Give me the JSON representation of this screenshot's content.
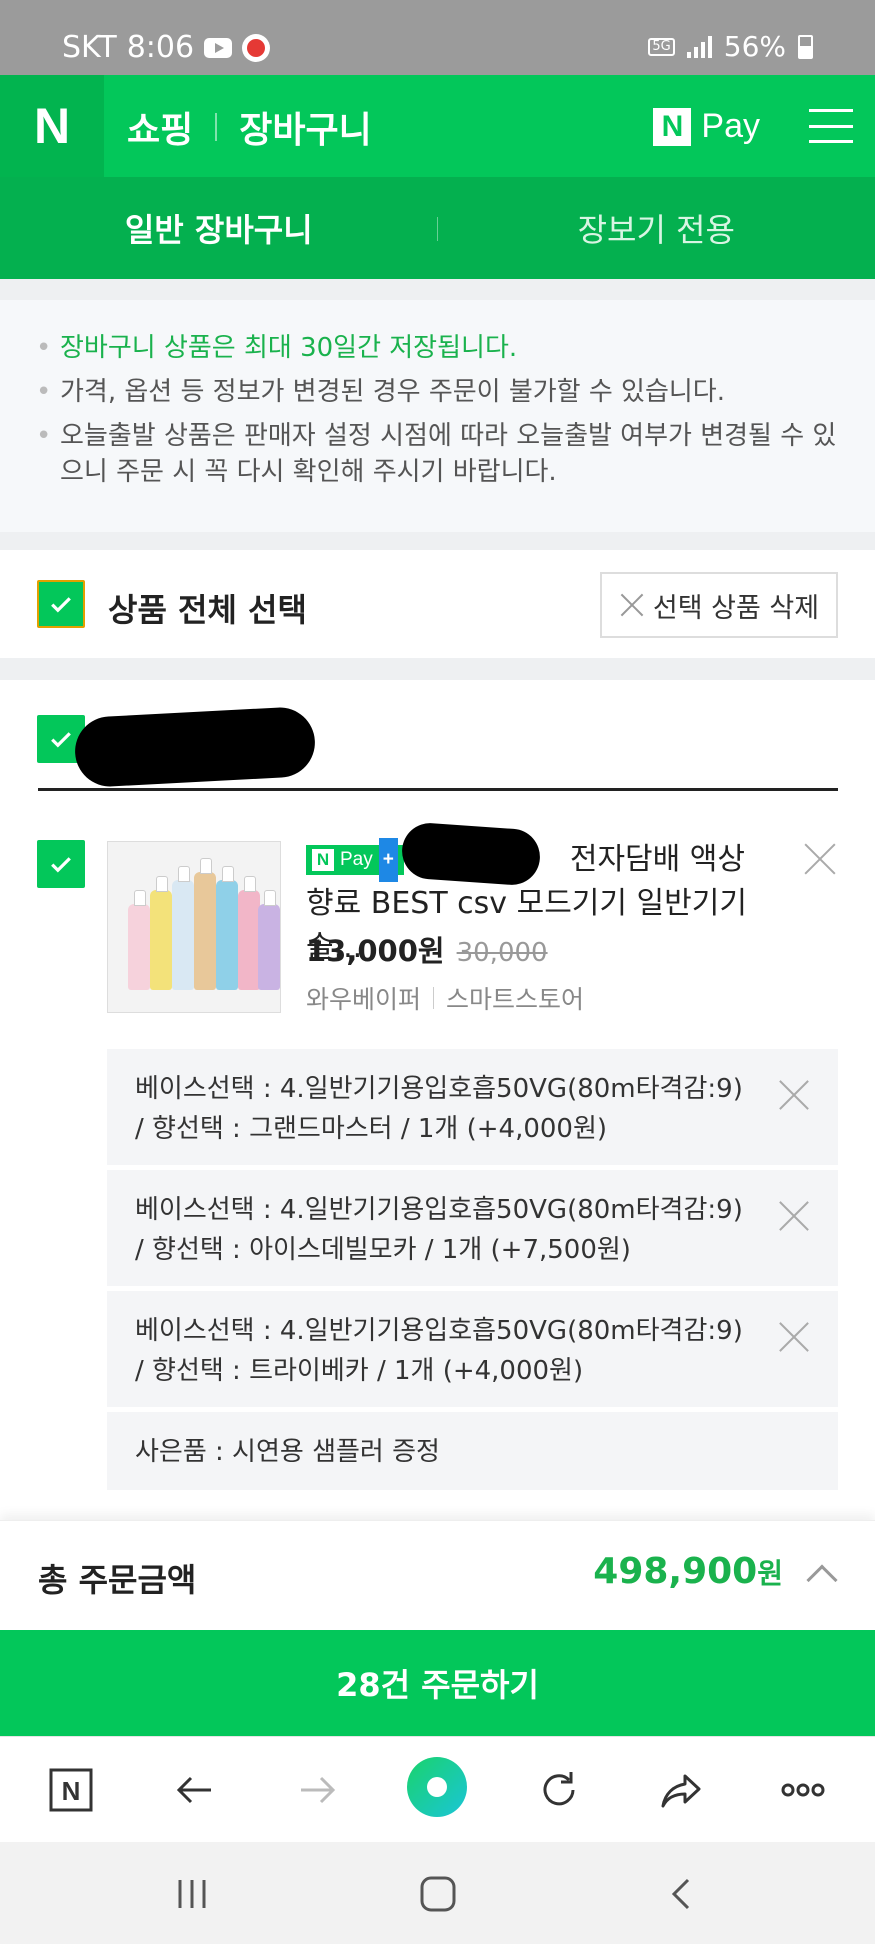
{
  "status_bar": {
    "carrier": "SKT",
    "time": "8:06",
    "network": "5G",
    "battery": "56%"
  },
  "header": {
    "logo": "N",
    "title_shopping": "쇼핑",
    "title_cart": "장바구니",
    "npay_label": "Pay",
    "menu_icon": "hamburger-icon"
  },
  "tabs": [
    {
      "label": "일반 장바구니",
      "active": true
    },
    {
      "label": "장보기 전용",
      "active": false
    }
  ],
  "notices": [
    "장바구니 상품은 최대 30일간 저장됩니다.",
    "가격, 옵션 등 정보가 변경된 경우 주문이 불가할 수 있습니다.",
    "오늘출발 상품은 판매자 설정 시점에 따라 오늘출발 여부가 변경될 수 있으니 주문 시 꼭 다시 확인해 주시기 바랍니다."
  ],
  "select_all": {
    "label": "상품 전체 선택",
    "checked": true,
    "delete_label": "선택 상품 삭제"
  },
  "product": {
    "badge": "Pay",
    "title_visible": "전자담배 액상 향료 BEST csv 모드기기 일반기기 솔...",
    "price": "13,000원",
    "original_price": "30,000",
    "seller": "와우베이퍼",
    "store_type": "스마트스토어"
  },
  "options": [
    "베이스선택 : 4.일반기기용입호흡50VG(80m타격감:9) / 향선택 : 그랜드마스터 / 1개 (+4,000원)",
    "베이스선택 : 4.일반기기용입호흡50VG(80m타격감:9) / 향선택 : 아이스데빌모카 / 1개 (+7,500원)",
    "베이스선택 : 4.일반기기용입호흡50VG(80m타격감:9) / 향선택 : 트라이베카 / 1개 (+4,000원)"
  ],
  "gift": "사은품 : 시연용 샘플러 증정",
  "total": {
    "label": "총 주문금액",
    "amount": "498,900",
    "unit": "원"
  },
  "order_button": "28건 주문하기",
  "colors": {
    "brand": "#03c75a",
    "price_green": "#1ab24d"
  }
}
